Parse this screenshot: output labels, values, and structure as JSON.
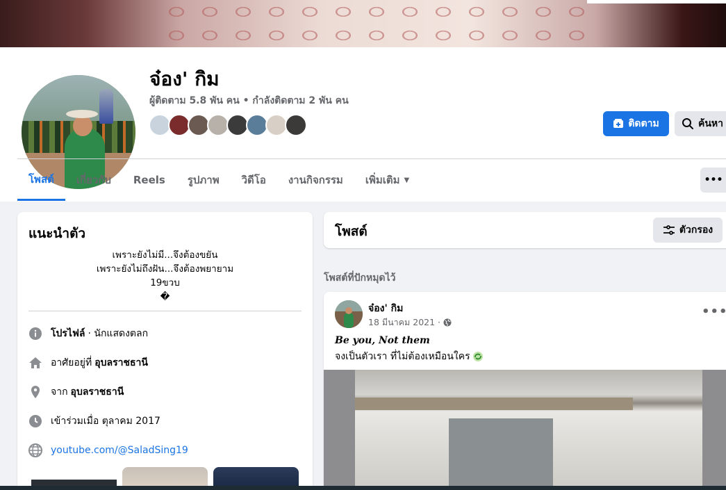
{
  "profile": {
    "name": "จ๋อง' กิม",
    "stats": "ผู้ติดตาม 5.8 พัน คน • กำลังติดตาม 2 พัน คน",
    "friend_avatar_colors": [
      "#c9d3de",
      "#7a2b2b",
      "#6b5a52",
      "#b7b1aa",
      "#3b3b3b",
      "#5a7d9a",
      "#d8cfc6",
      "#3c3a38"
    ]
  },
  "actions": {
    "follow_label": "ติดตาม",
    "search_label": "ค้นหา",
    "more_label": "•••"
  },
  "tabs": [
    {
      "label": "โพสต์"
    },
    {
      "label": "เกี่ยวกับ"
    },
    {
      "label": "Reels"
    },
    {
      "label": "รูปภาพ"
    },
    {
      "label": "วิดีโอ"
    },
    {
      "label": "งานกิจกรรม"
    },
    {
      "label": "เพิ่มเติม"
    }
  ],
  "intro": {
    "title": "แนะนำตัว",
    "bio_lines": [
      "เพราะยังไม่มี...จึงต้องขยัน",
      "เพราะยังไม่ถึงฝัน...จึงต้องพยายาม",
      "19ขวบ",
      "�"
    ],
    "profile_label": "โปรไฟล์",
    "profile_value": " · นักแสดงตลก",
    "lives_prefix": "อาศัยอยู่ที่",
    "lives_value": "อุบลราชธานี",
    "from_prefix": "จาก",
    "from_value": "อุบลราชธานี",
    "joined": "เข้าร่วมเมื่อ ตุลาคม 2017",
    "website": "youtube.com/@SaladSing19"
  },
  "posts": {
    "title": "โพสต์",
    "filter_label": "ตัวกรอง",
    "pinned_label": "โพสต์ที่ปักหมุดไว้",
    "post": {
      "author": "จ๋อง' กิม",
      "date": "18 มีนาคม 2021 ·",
      "line1": "Be you, Not them",
      "line2": "จงเป็นตัวเรา ที่ไม่ต้องเหมือนใคร",
      "more": "•••"
    }
  },
  "colors": {
    "accent": "#1b74e4",
    "secondary_text": "#65676b",
    "page_bg": "#f0f2f5"
  }
}
